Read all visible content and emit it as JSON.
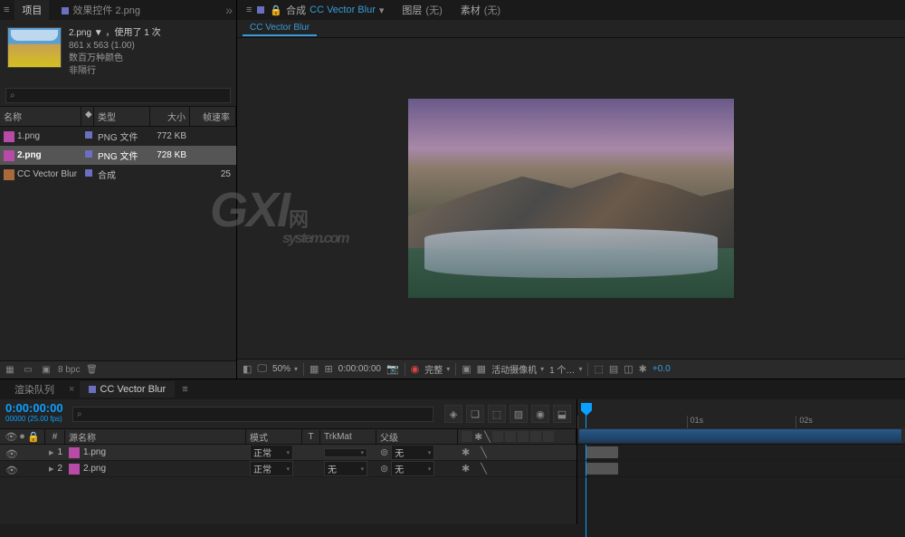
{
  "panels": {
    "project": {
      "tab_label": "项目",
      "effects_tab": "效果控件 2.png"
    },
    "asset": {
      "title": "2.png ▼ ，使用了 1 次",
      "dims": "861 x 563 (1.00)",
      "colors": "数百万种颜色",
      "alpha": "非隔行"
    },
    "search_placeholder": "⌕",
    "list": {
      "col_name": "名称",
      "col_tag": "◆",
      "col_type": "类型",
      "col_size": "大小",
      "col_fr": "帧速率",
      "rows": [
        {
          "name": "1.png",
          "type": "PNG 文件",
          "size": "772 KB",
          "fr": ""
        },
        {
          "name": "2.png",
          "type": "PNG 文件",
          "size": "728 KB",
          "fr": ""
        },
        {
          "name": "CC Vector Blur",
          "type": "合成",
          "size": "",
          "fr": "25"
        }
      ]
    },
    "footer_bpc": "8 bpc"
  },
  "comp": {
    "label_comp": "合成",
    "name": "CC Vector Blur",
    "layer_label": "图层",
    "source_label": "素材",
    "none": "(无)",
    "sub_tab": "CC Vector Blur"
  },
  "viewer_footer": {
    "zoom": "50%",
    "timecode": "0:00:00:00",
    "quality": "完整",
    "camera": "活动摄像机",
    "views": "1 个…",
    "exposure": "+0.0"
  },
  "timeline": {
    "render_tab": "渲染队列",
    "comp_tab": "CC Vector Blur",
    "timecode": "0:00:00:00",
    "timecode_sub": "00000 (25.00 fps)",
    "search_placeholder": "⌕",
    "cols": {
      "src": "源名称",
      "mode": "模式",
      "t": "T",
      "trk": "TrkMat",
      "parent": "父级"
    },
    "layers": [
      {
        "idx": "1",
        "name": "1.png",
        "mode": "正常",
        "trk": "",
        "parent": "无"
      },
      {
        "idx": "2",
        "name": "2.png",
        "mode": "正常",
        "trk": "无",
        "parent": "无"
      }
    ],
    "ruler": [
      "",
      "01s",
      "02s"
    ]
  },
  "watermark_big": "GXI",
  "watermark_small": "网",
  "watermark_sub": "system.com"
}
